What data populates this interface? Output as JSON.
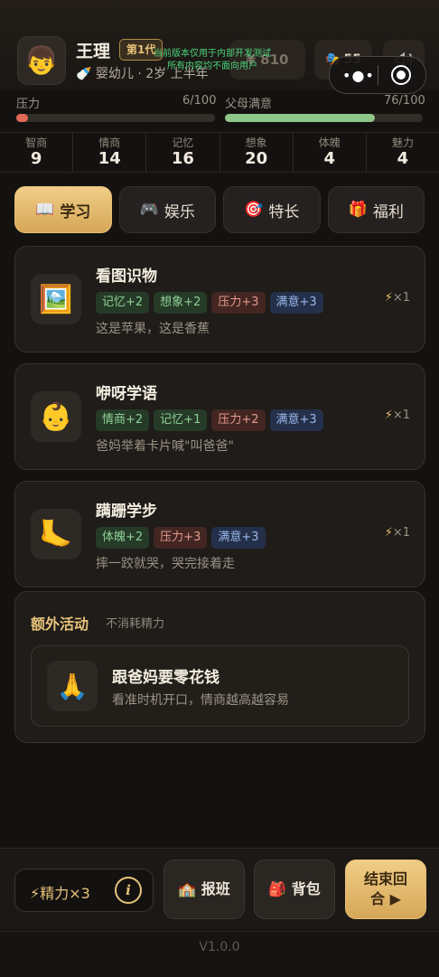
{
  "header": {
    "avatar_icon": "boy-face-icon",
    "avatar_glyph": "👦",
    "name": "王理",
    "generation_badge": "第1代",
    "stage_icon": "baby-bottle-icon",
    "stage_glyph": "🍼",
    "stage_text": "婴幼儿 · 2岁 上半年",
    "money_icon": "coin-icon",
    "money_value": "¥ 810",
    "mask_icon": "theater-mask-icon",
    "mask_glyph": "🎭",
    "mask_value": "55",
    "sound_icon": "speaker-icon",
    "dev_notice_line1": "当前版本仅用于内部开发测试",
    "dev_notice_line2": "所有内容均不面向用户"
  },
  "meters": {
    "pressure": {
      "label": "压力",
      "value": 6,
      "max": 100,
      "text": "6/100",
      "color": "#e06a55"
    },
    "parent_satisfaction": {
      "label": "父母满意",
      "value": 76,
      "max": 100,
      "text": "76/100",
      "color": "#8fc78a"
    }
  },
  "stats": [
    {
      "label": "智商",
      "value": "9"
    },
    {
      "label": "情商",
      "value": "14"
    },
    {
      "label": "记忆",
      "value": "16"
    },
    {
      "label": "想象",
      "value": "20"
    },
    {
      "label": "体魄",
      "value": "4"
    },
    {
      "label": "魅力",
      "value": "4"
    }
  ],
  "tabs": [
    {
      "label": "学习",
      "glyph": "📖",
      "icon": "book-icon",
      "active": true
    },
    {
      "label": "娱乐",
      "glyph": "🎮",
      "icon": "gamepad-icon",
      "active": false
    },
    {
      "label": "特长",
      "glyph": "🎯",
      "icon": "target-icon",
      "active": false
    },
    {
      "label": "福利",
      "glyph": "🎁",
      "icon": "gift-icon",
      "active": false
    }
  ],
  "activities": [
    {
      "title": "看图识物",
      "icon": "picture-icon",
      "glyph": "🖼️",
      "tags": [
        {
          "text": "记忆+2",
          "kind": "green"
        },
        {
          "text": "想象+2",
          "kind": "green"
        },
        {
          "text": "压力+3",
          "kind": "red"
        },
        {
          "text": "满意+3",
          "kind": "blue"
        }
      ],
      "desc": "这是苹果，这是香蕉",
      "cost": "×1"
    },
    {
      "title": "咿呀学语",
      "icon": "baby-face-icon",
      "glyph": "👶",
      "tags": [
        {
          "text": "情商+2",
          "kind": "green"
        },
        {
          "text": "记忆+1",
          "kind": "green"
        },
        {
          "text": "压力+2",
          "kind": "red"
        },
        {
          "text": "满意+3",
          "kind": "blue"
        }
      ],
      "desc": "爸妈举着卡片喊\"叫爸爸\"",
      "cost": "×1"
    },
    {
      "title": "蹒跚学步",
      "icon": "foot-icon",
      "glyph": "🦶",
      "tags": [
        {
          "text": "体魄+2",
          "kind": "green"
        },
        {
          "text": "压力+3",
          "kind": "red"
        },
        {
          "text": "满意+3",
          "kind": "blue"
        }
      ],
      "desc": "摔一跤就哭，哭完接着走",
      "cost": "×1"
    }
  ],
  "extra": {
    "title": "额外活动",
    "subtitle": "不消耗精力",
    "item_title": "跟爸妈要零花钱",
    "item_desc": "看准时机开口，情商越高越容易",
    "item_icon": "praying-hands-icon",
    "item_glyph": "🙏"
  },
  "bottom": {
    "energy_label": "精力×3",
    "info_glyph": "i",
    "tutor_label": "报班",
    "tutor_icon": "school-icon",
    "tutor_glyph": "🏫",
    "bag_label": "背包",
    "bag_icon": "backpack-icon",
    "bag_glyph": "🎒",
    "end_label": "结束回合 ▶"
  },
  "version": "V1.0.0"
}
